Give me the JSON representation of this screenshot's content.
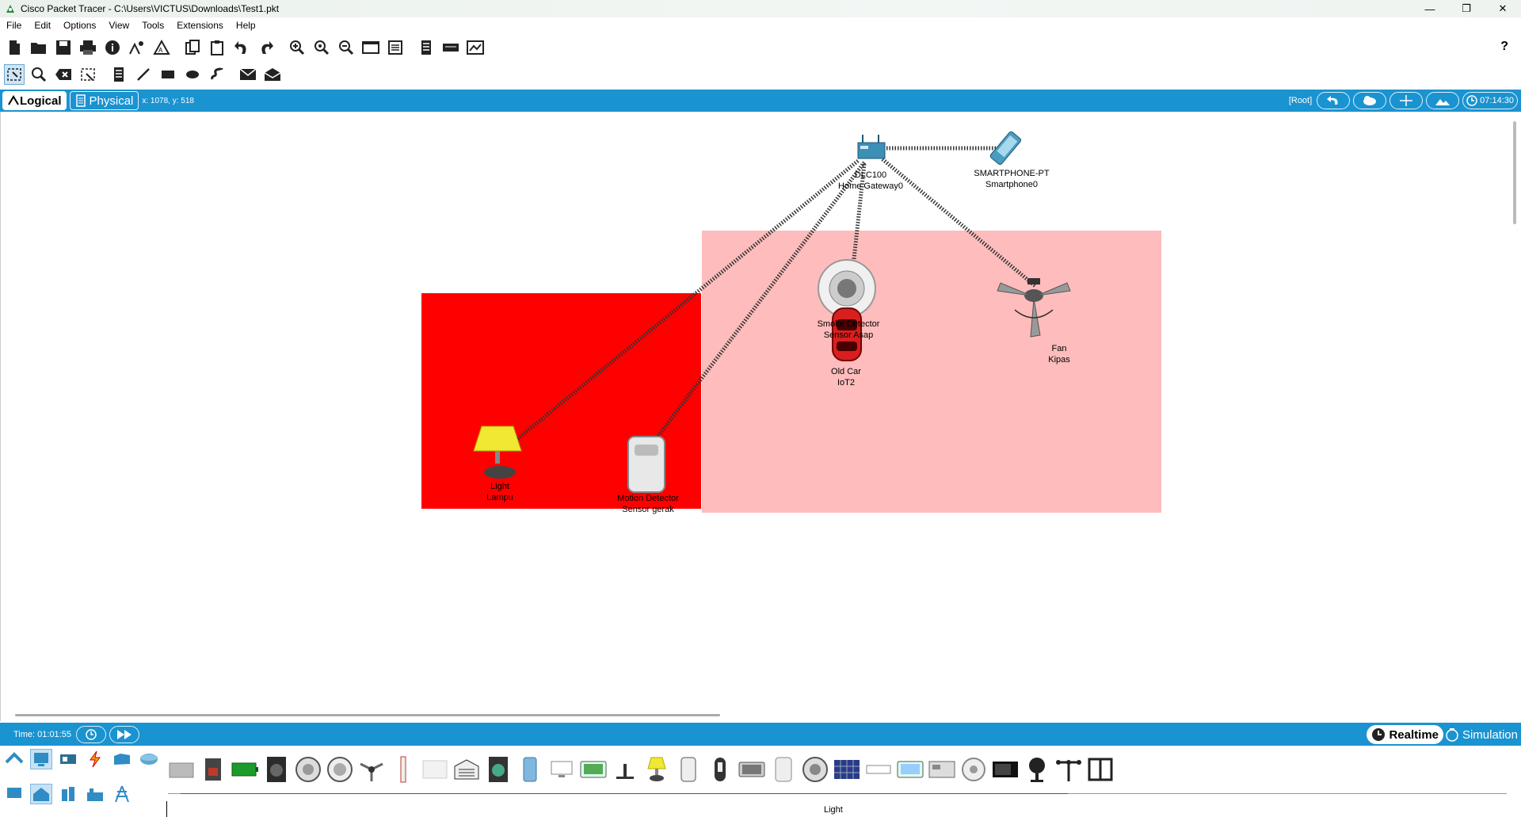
{
  "window": {
    "title": "Cisco Packet Tracer - C:\\Users\\VICTUS\\Downloads\\Test1.pkt",
    "minimize": "—",
    "maximize": "❐",
    "close": "✕"
  },
  "menu": [
    "File",
    "Edit",
    "Options",
    "View",
    "Tools",
    "Extensions",
    "Help"
  ],
  "toolbar": {
    "help": "?"
  },
  "workspace": {
    "logical_tab": "Logical",
    "physical_tab": "Physical",
    "coords": "x: 1078, y: 518",
    "root": "[Root]",
    "clock": "07:14:30"
  },
  "devices": {
    "gateway": {
      "line1": "DLC100",
      "line2": "Home Gateway0"
    },
    "smartphone": {
      "line1": "SMARTPHONE-PT",
      "line2": "Smartphone0"
    },
    "smoke": {
      "line1": "Smoke Detector",
      "line2": "Sensor Asap"
    },
    "car": {
      "line1": "Old Car",
      "line2": "IoT2"
    },
    "fan": {
      "line1": "Fan",
      "line2": "Kipas"
    },
    "light": {
      "line1": "Light",
      "line2": "Lampu"
    },
    "motion": {
      "line1": "Motion Detector",
      "line2": "Sensor gerak"
    }
  },
  "colors": {
    "zone_red": "#ff0000",
    "zone_pink": "#ffbcbc",
    "accent_blue": "#1a93d1"
  },
  "status": {
    "time": "Time: 01:01:55",
    "realtime": "Realtime",
    "simulation": "Simulation"
  },
  "palette": {
    "selected_label": "Light"
  }
}
